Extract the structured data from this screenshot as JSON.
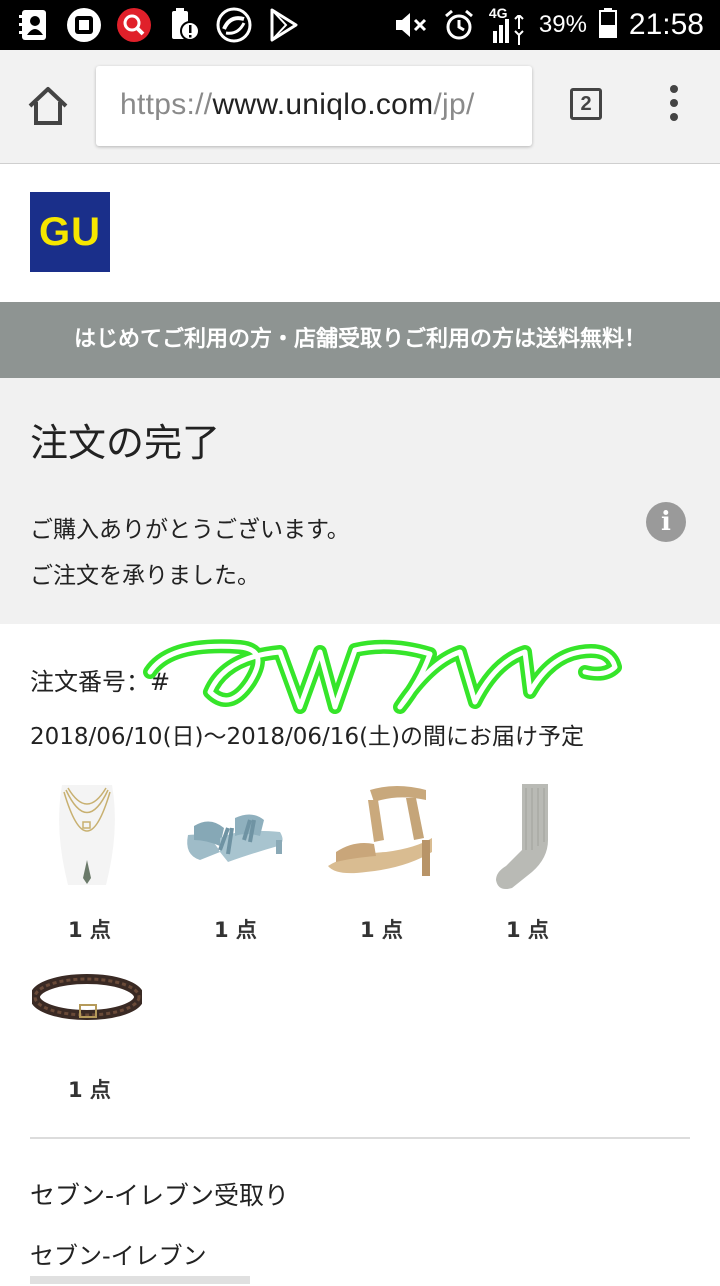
{
  "status_bar": {
    "icons": [
      "contacts-icon",
      "app-icon",
      "search-app-icon",
      "battery-alert-icon",
      "sync-icon",
      "play-store-icon"
    ],
    "network": "4G",
    "battery": "39%",
    "time": "21:58"
  },
  "browser": {
    "url_scheme": "https://",
    "url_host": "www.uniqlo.com",
    "url_rest": "/jp/",
    "tab_count": "2"
  },
  "logo": {
    "text": "GU",
    "bg_color": "#1a2f8a",
    "text_color": "#f6e600"
  },
  "banner": {
    "text": "はじめてご利用の方・店舗受取りご利用の方は送料無料！",
    "bg_color": "#8e9492"
  },
  "complete": {
    "title": "注文の完了",
    "message1": "ご購入ありがとうございます。",
    "message2": "ご注文を承りました。"
  },
  "order": {
    "number_label": "注文番号：#",
    "delivery": "2018/06/10(日)〜2018/06/16(土)の間にお届け予定"
  },
  "products": [
    {
      "name": "necklace",
      "qty": "1 点"
    },
    {
      "name": "mule-sandal",
      "qty": "1 点"
    },
    {
      "name": "ankle-strap-sandal",
      "qty": "1 点"
    },
    {
      "name": "socks",
      "qty": "1 点"
    },
    {
      "name": "belt",
      "qty": "1 点"
    }
  ],
  "pickup": {
    "title": "セブン-イレブン受取り",
    "store": "セブン-イレブン"
  }
}
